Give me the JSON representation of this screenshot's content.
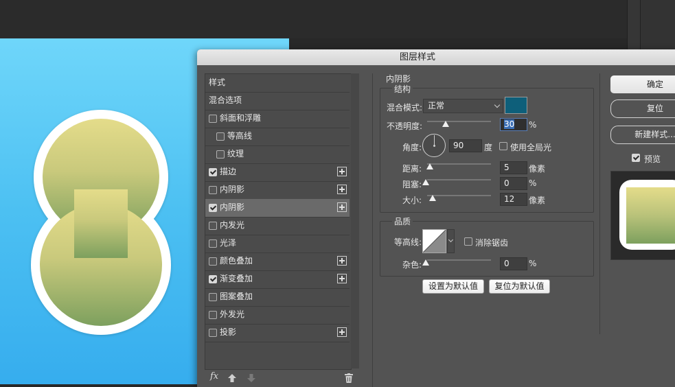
{
  "dialog": {
    "title": "图层样式"
  },
  "style_list": [
    {
      "label": "样式",
      "checkbox": false,
      "plus": false,
      "indent": 0,
      "selected": false
    },
    {
      "label": "混合选项",
      "checkbox": false,
      "plus": false,
      "indent": 0,
      "selected": false
    },
    {
      "label": "斜面和浮雕",
      "checkbox": true,
      "checked": false,
      "plus": false,
      "indent": 0,
      "selected": false
    },
    {
      "label": "等高线",
      "checkbox": true,
      "checked": false,
      "plus": false,
      "indent": 1,
      "selected": false
    },
    {
      "label": "纹理",
      "checkbox": true,
      "checked": false,
      "plus": false,
      "indent": 1,
      "selected": false
    },
    {
      "label": "描边",
      "checkbox": true,
      "checked": true,
      "plus": true,
      "indent": 0,
      "selected": false
    },
    {
      "label": "内阴影",
      "checkbox": true,
      "checked": false,
      "plus": true,
      "indent": 0,
      "selected": false
    },
    {
      "label": "内阴影",
      "checkbox": true,
      "checked": true,
      "plus": true,
      "indent": 0,
      "selected": true
    },
    {
      "label": "内发光",
      "checkbox": true,
      "checked": false,
      "plus": false,
      "indent": 0,
      "selected": false
    },
    {
      "label": "光泽",
      "checkbox": true,
      "checked": false,
      "plus": false,
      "indent": 0,
      "selected": false
    },
    {
      "label": "颜色叠加",
      "checkbox": true,
      "checked": false,
      "plus": true,
      "indent": 0,
      "selected": false
    },
    {
      "label": "渐变叠加",
      "checkbox": true,
      "checked": true,
      "plus": true,
      "indent": 0,
      "selected": false
    },
    {
      "label": "图案叠加",
      "checkbox": true,
      "checked": false,
      "plus": false,
      "indent": 0,
      "selected": false
    },
    {
      "label": "外发光",
      "checkbox": true,
      "checked": false,
      "plus": false,
      "indent": 0,
      "selected": false
    },
    {
      "label": "投影",
      "checkbox": true,
      "checked": false,
      "plus": true,
      "indent": 0,
      "selected": false
    }
  ],
  "bottom_bar": {
    "fx_label": "fx"
  },
  "inner_shadow": {
    "section_title": "内阴影",
    "structure_title": "结构",
    "blend_mode_label": "混合模式:",
    "blend_mode_value": "正常",
    "shadow_color": "#0e5f7a",
    "opacity_label": "不透明度:",
    "opacity_value": "30",
    "opacity_unit": "%",
    "angle_label": "角度:",
    "angle_value": "90",
    "angle_unit": "度",
    "global_light_label": "使用全局光",
    "distance_label": "距离:",
    "distance_value": "5",
    "distance_unit": "像素",
    "choke_label": "阻塞:",
    "choke_value": "0",
    "choke_unit": "%",
    "size_label": "大小:",
    "size_value": "12",
    "size_unit": "像素",
    "quality_title": "品质",
    "contour_label": "等高线:",
    "antialias_label": "消除锯齿",
    "noise_label": "杂色:",
    "noise_value": "0",
    "noise_unit": "%",
    "set_default_label": "设置为默认值",
    "reset_default_label": "复位为默认值"
  },
  "side_buttons": {
    "ok": "确定",
    "reset": "复位",
    "new_style": "新建样式...",
    "preview": "预览"
  },
  "colors": {
    "canvas_top": "#6fd6fa",
    "canvas_bottom": "#36adee",
    "shape_top": "#e4dc8a",
    "shape_bottom": "#7da05e",
    "accent": "#3b6fb6"
  }
}
